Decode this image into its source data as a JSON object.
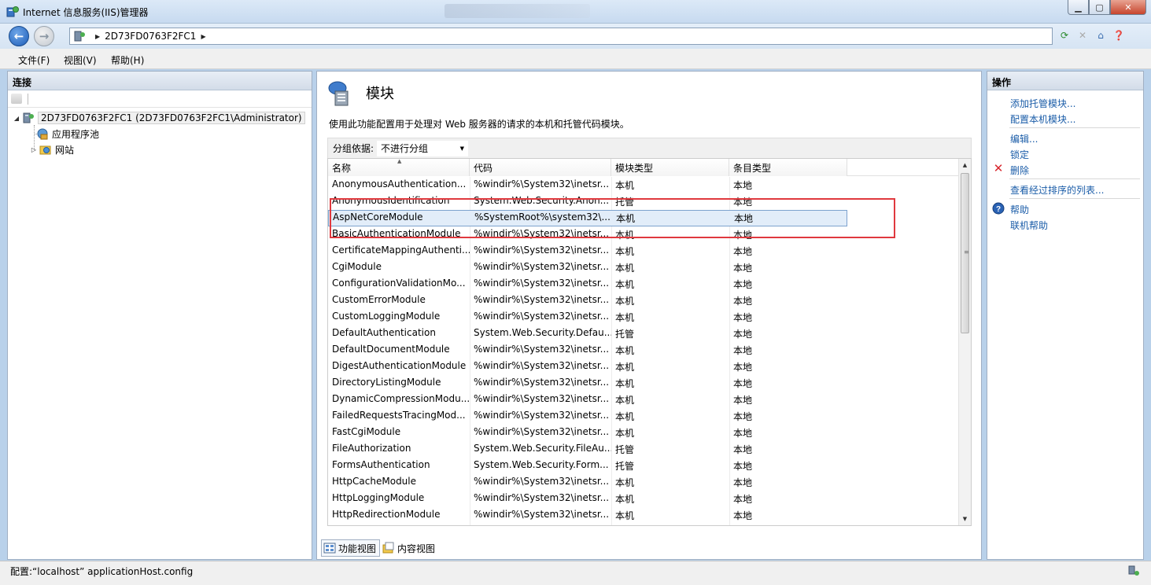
{
  "window": {
    "title": "Internet 信息服务(IIS)管理器"
  },
  "address": {
    "crumbs": [
      "2D73FD0763F2FC1"
    ]
  },
  "menu": {
    "items": [
      "文件(F)",
      "视图(V)",
      "帮助(H)"
    ]
  },
  "connections": {
    "title": "连接",
    "tree": {
      "server": "2D73FD0763F2FC1 (2D73FD0763F2FC1\\Administrator)",
      "children": [
        "应用程序池",
        "网站"
      ]
    }
  },
  "feature": {
    "title": "模块",
    "description": "使用此功能配置用于处理对 Web 服务器的请求的本机和托管代码模块。",
    "group_label": "分组依据:",
    "group_value": "不进行分组",
    "columns": [
      "名称",
      "代码",
      "模块类型",
      "条目类型"
    ],
    "rows": [
      [
        "AnonymousAuthentication...",
        "%windir%\\System32\\inetsr...",
        "本机",
        "本地"
      ],
      [
        "AnonymousIdentification",
        "System.Web.Security.Anon...",
        "托管",
        "本地"
      ],
      [
        "AspNetCoreModule",
        "%SystemRoot%\\system32\\...",
        "本机",
        "本地"
      ],
      [
        "BasicAuthenticationModule",
        "%windir%\\System32\\inetsr...",
        "本机",
        "本地"
      ],
      [
        "CertificateMappingAuthenti...",
        "%windir%\\System32\\inetsr...",
        "本机",
        "本地"
      ],
      [
        "CgiModule",
        "%windir%\\System32\\inetsr...",
        "本机",
        "本地"
      ],
      [
        "ConfigurationValidationMo...",
        "%windir%\\System32\\inetsr...",
        "本机",
        "本地"
      ],
      [
        "CustomErrorModule",
        "%windir%\\System32\\inetsr...",
        "本机",
        "本地"
      ],
      [
        "CustomLoggingModule",
        "%windir%\\System32\\inetsr...",
        "本机",
        "本地"
      ],
      [
        "DefaultAuthentication",
        "System.Web.Security.Defau...",
        "托管",
        "本地"
      ],
      [
        "DefaultDocumentModule",
        "%windir%\\System32\\inetsr...",
        "本机",
        "本地"
      ],
      [
        "DigestAuthenticationModule",
        "%windir%\\System32\\inetsr...",
        "本机",
        "本地"
      ],
      [
        "DirectoryListingModule",
        "%windir%\\System32\\inetsr...",
        "本机",
        "本地"
      ],
      [
        "DynamicCompressionModu...",
        "%windir%\\System32\\inetsr...",
        "本机",
        "本地"
      ],
      [
        "FailedRequestsTracingMod...",
        "%windir%\\System32\\inetsr...",
        "本机",
        "本地"
      ],
      [
        "FastCgiModule",
        "%windir%\\System32\\inetsr...",
        "本机",
        "本地"
      ],
      [
        "FileAuthorization",
        "System.Web.Security.FileAu...",
        "托管",
        "本地"
      ],
      [
        "FormsAuthentication",
        "System.Web.Security.Form...",
        "托管",
        "本地"
      ],
      [
        "HttpCacheModule",
        "%windir%\\System32\\inetsr...",
        "本机",
        "本地"
      ],
      [
        "HttpLoggingModule",
        "%windir%\\System32\\inetsr...",
        "本机",
        "本地"
      ],
      [
        "HttpRedirectionModule",
        "%windir%\\System32\\inetsr...",
        "本机",
        "本地"
      ]
    ],
    "selected_row": 2,
    "view_tabs": [
      "功能视图",
      "内容视图"
    ]
  },
  "actions": {
    "title": "操作",
    "add_managed": "添加托管模块...",
    "config_native": "配置本机模块...",
    "edit": "编辑...",
    "lock": "锁定",
    "delete": "删除",
    "view_ordered": "查看经过排序的列表...",
    "help": "帮助",
    "online_help": "联机帮助"
  },
  "status": {
    "text": "配置:“localhost” applicationHost.config"
  },
  "colors": {
    "highlight": "#e0393e",
    "link": "#1a5ca8",
    "selection": "#e2edf9"
  }
}
